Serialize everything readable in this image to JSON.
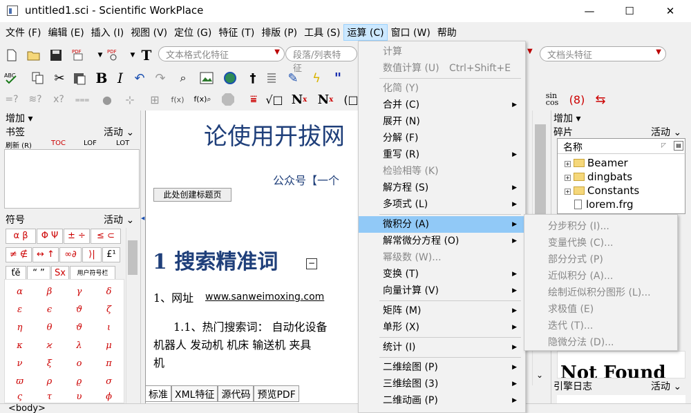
{
  "window": {
    "title": "untitled1.sci - Scientific WorkPlace",
    "minimize": "—",
    "maximize": "☐",
    "close": "✕"
  },
  "menubar": [
    "文件 (F)",
    "编辑 (E)",
    "插入 (I)",
    "视图 (V)",
    "定位 (G)",
    "特征 (T)",
    "排版 (P)",
    "工具 (S)",
    "运算 (C)",
    "窗口 (W)",
    "帮助"
  ],
  "toolbar1": {
    "combo1": "文本格式化特征",
    "combo2": "段落/列表特征",
    "combo3": "文档头特征",
    "text_tool": "T"
  },
  "toolbar2": {
    "bold": "B",
    "italic": "I",
    "dagger": "†",
    "quote": "\""
  },
  "toolbar3": {
    "sin_cos": "sin\ncos",
    "N_sup": "N",
    "N_sup_x": "x",
    "N_sub": "N",
    "N_sub_x": "x"
  },
  "left": {
    "add": "增加 ▾",
    "bookmarks": "书签",
    "active": "活动",
    "bm_cols": [
      "刷新 (R)",
      "TOC",
      "LOF",
      "LOT"
    ],
    "symbols": "符号",
    "symbol_tabs": [
      "α β",
      "Φ Ψ",
      "± ÷",
      "≤ ⊂",
      "≠ ∉",
      "↔ ↑",
      "∞∂",
      "⟩|",
      "£¹",
      "ťě",
      "“ ”",
      "Sx",
      "用户符号栏"
    ],
    "greek": [
      "α",
      "β",
      "γ",
      "δ",
      "ε",
      "ϵ",
      "ϑ",
      "ζ",
      "η",
      "θ",
      "ϑ",
      "ι",
      "κ",
      "ϰ",
      "λ",
      "μ",
      "ν",
      "ξ",
      "ο",
      "π",
      "ϖ",
      "ρ",
      "ϱ",
      "σ",
      "ς",
      "τ",
      "υ",
      "ϕ"
    ]
  },
  "doc": {
    "heading": "论使用开拔网",
    "subtitle": "公众号【一个",
    "create_title_btn": "此处创建标题页",
    "section": "1  搜索精准词",
    "item1_label": "1、网址",
    "item1_url": "www.sanweimoxing.com",
    "item2": "1.1、热门搜索词：  自动化设备",
    "item2_cont": "机器人 发动机 机床 输送机 夹具",
    "item2_end": "机",
    "tabs": [
      "标准",
      "XML特征",
      "源代码",
      "预览PDF"
    ]
  },
  "right": {
    "add": "增加 ▾",
    "fragments": "碎片",
    "active": "活动",
    "col_name": "名称",
    "items": [
      "Beamer",
      "dingbats",
      "Constants",
      "lorem.frg"
    ],
    "log": "引擎日志",
    "log_active": "活动",
    "notfound": "Not Found"
  },
  "calc_menu": {
    "items": [
      {
        "label": "计算",
        "disabled": true
      },
      {
        "label": "数值计算 (U)",
        "shortcut": "Ctrl+Shift+E",
        "disabled": true
      },
      {
        "label": "化简 (Y)",
        "disabled": true
      },
      {
        "label": "合并 (C)",
        "sub": true
      },
      {
        "label": "展开 (N)"
      },
      {
        "label": "分解 (F)"
      },
      {
        "label": "重写 (R)",
        "sub": true
      },
      {
        "label": "检验相等 (K)",
        "disabled": true
      },
      {
        "label": "解方程 (S)",
        "sub": true
      },
      {
        "label": "多项式 (L)",
        "sub": true
      },
      {
        "label": "微积分 (A)",
        "sub": true,
        "highlighted": true
      },
      {
        "label": "解常微分方程 (O)",
        "sub": true
      },
      {
        "label": "幂级数 (W)...",
        "disabled": true
      },
      {
        "label": "变换 (T)",
        "sub": true
      },
      {
        "label": "向量计算 (V)",
        "sub": true
      },
      {
        "label": "矩阵 (M)",
        "sub": true
      },
      {
        "label": "单形 (X)",
        "sub": true
      },
      {
        "label": "统计 (I)",
        "sub": true
      },
      {
        "label": "二维绘图 (P)",
        "sub": true
      },
      {
        "label": "三维绘图 (3)",
        "sub": true
      },
      {
        "label": "二维动画 (P)",
        "sub": true
      }
    ],
    "submenu": [
      "分步积分 (I)...",
      "变量代换 (C)...",
      "部分分式 (P)",
      "近似积分 (A)...",
      "绘制近似积分图形 (L)...",
      "求极值 (E)",
      "迭代 (T)...",
      "隐微分法 (D)..."
    ]
  },
  "status": "<body>"
}
